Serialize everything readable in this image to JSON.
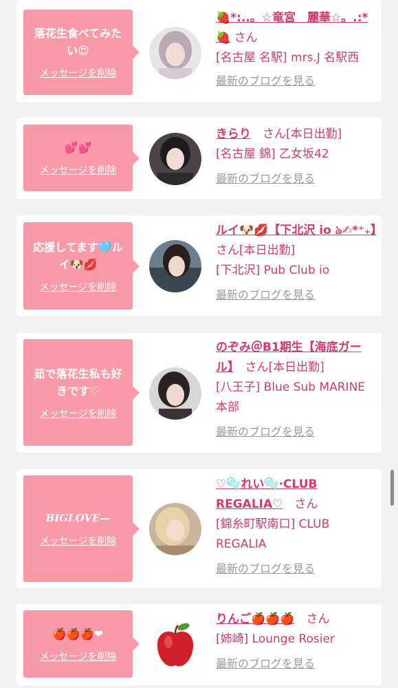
{
  "delete_label": "メッセージを削除",
  "blog_label": "最新のブログを見る",
  "san_label": "さん",
  "colors": {
    "bubble": "#f99aa8",
    "accent": "#d13b6b",
    "muted": "#9a9a9a",
    "background": "#f2f2f2"
  },
  "entries": [
    {
      "message": "落花生食べてみたい😍",
      "name": "🍓*:..。☆竜宮　麗華☆。.:*🍓",
      "status": "",
      "shop": "[名古屋 名駅] mrs.J 名駅西",
      "avatar": "avatar-portrait-1"
    },
    {
      "message": "💕💕",
      "name": "きらり",
      "status": "[本日出勤]",
      "shop": "[名古屋 錦] 乙女坂42",
      "avatar": "avatar-portrait-2"
    },
    {
      "message": "応援してます🩵ルイ🐶💋",
      "name": "ルイ🐶💋【下北沢 io ঌ✍︎*⁺₊】",
      "status": "[本日出勤]",
      "shop": "[下北沢] Pub Club io",
      "avatar": "avatar-portrait-3"
    },
    {
      "message": "茹で落花生私も好きです♡",
      "name": "のぞみ＠B1期生【海底ガール】",
      "status": "[本日出勤]",
      "shop": "[八王子] Blue Sub MARINE 本部",
      "avatar": "avatar-portrait-4"
    },
    {
      "message": "BIGLOVE—",
      "name": "♡🫧れい🫧·CLUB REGALIA♡",
      "status": "",
      "shop": "[錦糸町駅南口] CLUB REGALIA",
      "avatar": "avatar-portrait-5"
    },
    {
      "message": "🍎🍎🍎❤︎",
      "name": "りんご🍎🍎🍎",
      "status": "",
      "shop": "[姉崎] Lounge Rosier",
      "avatar": "apple-image"
    }
  ]
}
